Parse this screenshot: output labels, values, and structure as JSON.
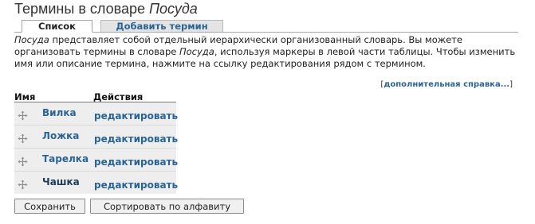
{
  "header": {
    "title_prefix": "Термины в словаре ",
    "vocabulary_name": "Посуда"
  },
  "tabs": [
    {
      "label": "Список",
      "active": true
    },
    {
      "label": "Добавить термин",
      "active": false
    }
  ],
  "description": {
    "vocab_1": "Посуда",
    "text_1": " представляет собой отдельный иерархически организованный словарь. Вы можете организовать термины в словаре ",
    "vocab_2": "Посуда",
    "text_2": ", используя маркеры в левой части таблицы. Чтобы изменить имя или описание термина, нажмите на ссылку редактирования рядом с термином."
  },
  "help": {
    "open_bracket": "[",
    "link_label": "дополнительная справка...",
    "close_bracket": "]"
  },
  "table": {
    "columns": [
      "Имя",
      "Действия"
    ],
    "rows": [
      {
        "name": "Вилка",
        "action": "редактировать"
      },
      {
        "name": "Ложка",
        "action": "редактировать"
      },
      {
        "name": "Тарелка",
        "action": "редактировать"
      },
      {
        "name": "Чашка",
        "action": "редактировать"
      }
    ]
  },
  "buttons": {
    "save": "Сохранить",
    "sort": "Сортировать по алфавиту"
  },
  "colors": {
    "link": "#2a6496",
    "row_background": "#eeeeee",
    "inactive_tab": "#e4e4e4"
  },
  "icons": {
    "drag_handle": "move-arrows-icon"
  }
}
